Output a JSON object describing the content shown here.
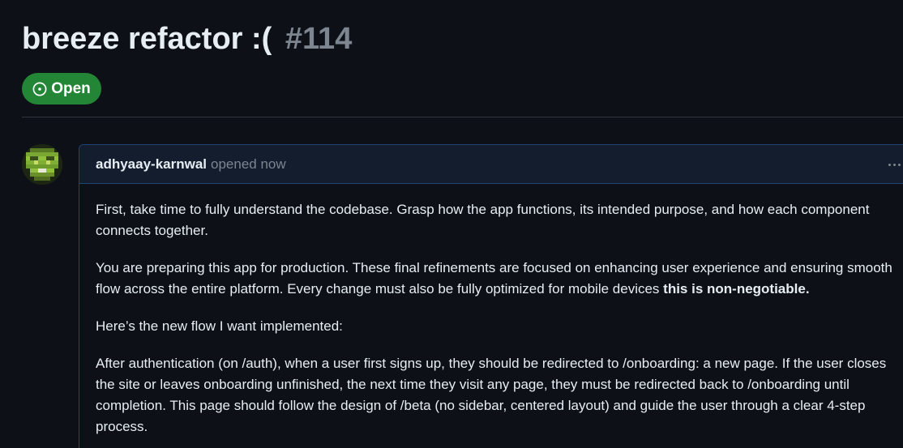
{
  "issue": {
    "title": "breeze refactor :(",
    "number": "#114",
    "state": "Open",
    "state_color": "#238636"
  },
  "comment": {
    "author": "adhyaay-karnwal",
    "timestamp": "opened now",
    "paragraphs": {
      "p1": "First, take time to fully understand the codebase. Grasp how the app functions, its intended purpose, and how each component connects together.",
      "p2_text": "You are preparing this app for production. These final refinements are focused on enhancing user experience and ensuring smooth flow across the entire platform. Every change must also be fully optimized for mobile devices ",
      "p2_strong": "this is non-negotiable.",
      "p3": "Here’s the new flow I want implemented:",
      "p4": "After authentication (on /auth), when a user first signs up, they should be redirected to /onboarding: a new page. If the user closes the site or leaves onboarding unfinished, the next time they visit any page, they must be redirected back to /onboarding until completion. This page should follow the design of /beta (no sidebar, centered layout) and guide the user through a clear 4-step process."
    }
  },
  "icons": {
    "state": "issue-opened-icon",
    "menu": "kebab-horizontal-icon"
  },
  "colors": {
    "background": "#0d1117",
    "accent_border": "#1f4475",
    "muted_text": "#7d8590"
  }
}
